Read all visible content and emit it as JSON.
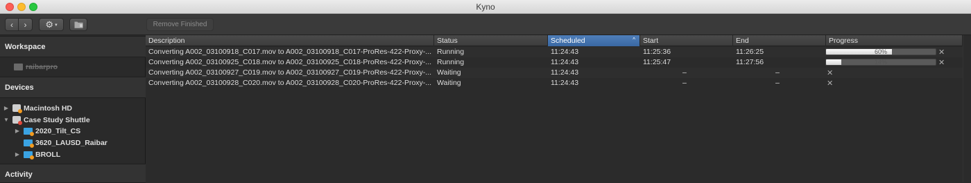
{
  "window": {
    "title": "Kyno"
  },
  "toolbar": {
    "back_icon": "‹",
    "forward_icon": "›",
    "gear_icon": "⚙",
    "gear_chevron": "▾",
    "remove_finished": "Remove Finished"
  },
  "sidebar": {
    "workspace": {
      "header": "Workspace",
      "items": [
        "raibarpro"
      ]
    },
    "devices": {
      "header": "Devices",
      "items": [
        {
          "label": "Macintosh HD",
          "expanded": false
        },
        {
          "label": "Case Study Shuttle",
          "expanded": true
        },
        {
          "label": "2020_Tilt_CS",
          "expanded": false
        },
        {
          "label": "3620_LAUSD_Raibar",
          "expanded": false
        },
        {
          "label": "BROLL",
          "expanded": false
        }
      ]
    },
    "activity": {
      "header": "Activity"
    }
  },
  "table": {
    "columns": [
      "Description",
      "Status",
      "Scheduled",
      "Start",
      "End",
      "Progress"
    ],
    "sorted_column": "Scheduled",
    "rows": [
      {
        "description": "Converting A002_03100918_C017.mov to A002_03100918_C017-ProRes-422-Proxy-...",
        "status": "Running",
        "scheduled": "11:24:43",
        "start": "11:25:36",
        "end": "11:26:25",
        "progress": 0.6,
        "progress_label": "60%"
      },
      {
        "description": "Converting A002_03100925_C018.mov to A002_03100925_C018-ProRes-422-Proxy-...",
        "status": "Running",
        "scheduled": "11:24:43",
        "start": "11:25:47",
        "end": "11:27:56",
        "progress": 0.14,
        "progress_label": "14%"
      },
      {
        "description": "Converting A002_03100927_C019.mov to A002_03100927_C019-ProRes-422-Proxy-...",
        "status": "Waiting",
        "scheduled": "11:24:43",
        "start": "–",
        "end": "–",
        "progress": null,
        "progress_label": ""
      },
      {
        "description": "Converting A002_03100928_C020.mov to A002_03100928_C020-ProRes-422-Proxy-...",
        "status": "Waiting",
        "scheduled": "11:24:43",
        "start": "–",
        "end": "–",
        "progress": null,
        "progress_label": ""
      }
    ],
    "cancel_icon": "✕",
    "sort_arrow": "^"
  },
  "colors": {
    "accent": "#3a68a3",
    "close": "#fc5f57",
    "minimize": "#fdbc2e",
    "maximize": "#28c840",
    "badge_red": "#e0483c",
    "badge_orange": "#f29a1f",
    "folder_blue": "#3aa3e3"
  }
}
